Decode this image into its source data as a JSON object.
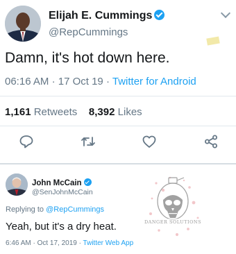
{
  "main_tweet": {
    "author_name": "Elijah E. Cummings",
    "handle": "@RepCummings",
    "text": "Damn, it's hot down here.",
    "time": "06:16 AM",
    "date": "17 Oct 19",
    "separator": "·",
    "source": "Twitter for Android",
    "retweets_count": "1,161",
    "retweets_label": "Retweets",
    "likes_count": "8,392",
    "likes_label": "Likes",
    "icons": [
      "verified-badge-icon",
      "chevron-down-icon",
      "reply-icon",
      "retweet-icon",
      "like-icon",
      "share-icon"
    ],
    "colors": {
      "accent": "#1da1f2",
      "secondary_text": "#657786",
      "primary_text": "#14171a",
      "divider": "#e1e8ed"
    }
  },
  "reply_tweet": {
    "author_name": "John McCain",
    "handle": "@SenJohnMcCain",
    "replying_prefix": "Replying to",
    "replying_to": "@RepCummings",
    "text": "Yeah, but it's a dry heat.",
    "timestamp": "6:46 AM · Oct 17, 2019 · ",
    "source": "Twitter Web App",
    "watermark_text": "DANGER SOLUTIONS"
  }
}
